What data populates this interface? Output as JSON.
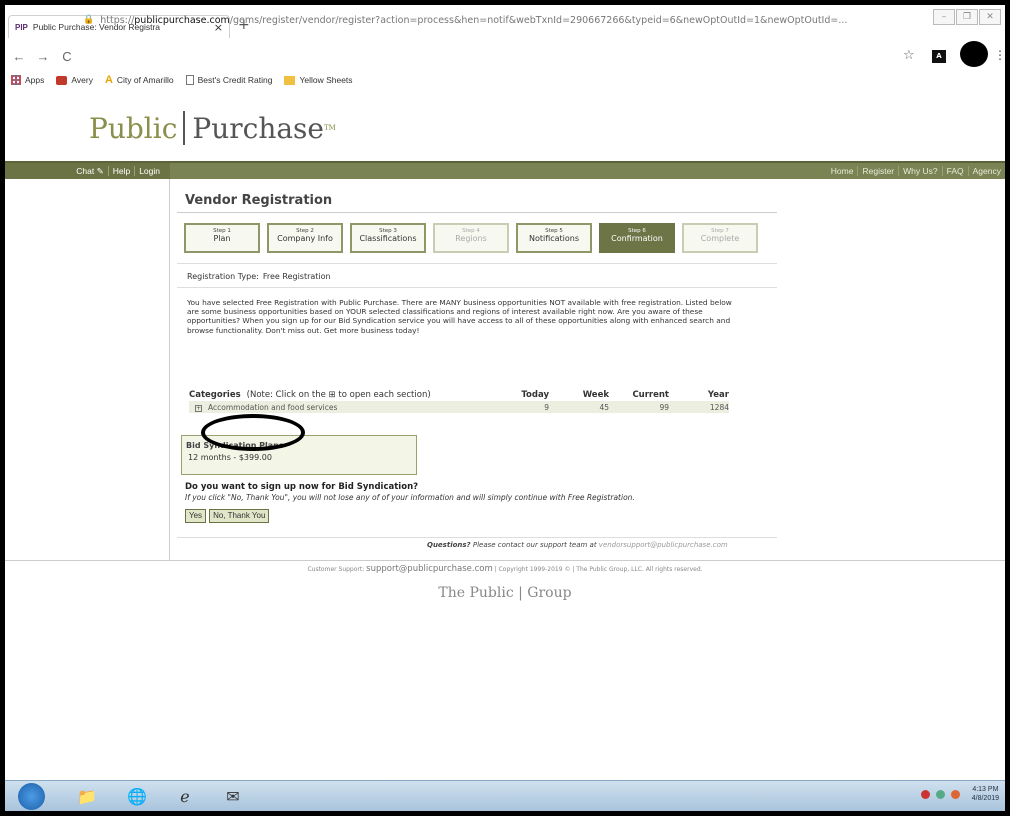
{
  "browser": {
    "tab_favicon": "PIP",
    "tab_title": "Public Purchase: Vendor Registra",
    "tab_close": "×",
    "new_tab": "+",
    "url_prefix": "https://",
    "url_domain": "publicpurchase.com",
    "url_path": "/gems/register/vendor/register?action=process&hen=notif&webTxnId=290667266&typeid=6&newOptOutId=1&newOptOutId=...",
    "bookmarks": [
      "Apps",
      "Avery",
      "City of Amarillo",
      "Best's Credit Rating",
      "Yellow Sheets"
    ]
  },
  "site": {
    "logo_left": "Public",
    "logo_right": "Purchase",
    "logo_tm": "TM",
    "left_nav": [
      "Chat ✎",
      "Help",
      "Login"
    ],
    "right_nav": [
      "Home",
      "Register",
      "Why Us?",
      "FAQ",
      "Agency"
    ]
  },
  "main": {
    "title": "Vendor Registration",
    "steps": [
      {
        "num": "Step 1",
        "label": "Plan",
        "state": "done"
      },
      {
        "num": "Step 2",
        "label": "Company Info",
        "state": "done"
      },
      {
        "num": "Step 3",
        "label": "Classifications",
        "state": "done"
      },
      {
        "num": "Step 4",
        "label": "Regions",
        "state": "off"
      },
      {
        "num": "Step 5",
        "label": "Notifications",
        "state": "done"
      },
      {
        "num": "Step 6",
        "label": "Confirmation",
        "state": "current"
      },
      {
        "num": "Step 7",
        "label": "Complete",
        "state": "off"
      }
    ],
    "reg_type_label": "Registration Type:",
    "reg_type_value": "Free Registration",
    "paragraph": "You have selected Free Registration with Public Purchase. There are MANY business opportunities NOT available with free registration. Listed below are some business opportunities based on YOUR selected classifications and regions of interest available right now. Are you aware of these opportunities? When you sign up for our Bid Syndication service you will have access to all of these opportunities along with enhanced search and browse functionality. Don't miss out. Get more business today!",
    "categories": {
      "header": "Categories",
      "note": "(Note: Click on the ⊞ to open each section)",
      "cols": [
        "Today",
        "Week",
        "Current",
        "Year"
      ],
      "rows": [
        {
          "name": "Accommodation and food services",
          "today": "9",
          "week": "45",
          "current": "99",
          "year": "1284"
        }
      ]
    },
    "plans_title": "Bid Syndication Plans",
    "plans_price": "12 months - $399.00",
    "ask": "Do you want to sign up now for Bid Syndication?",
    "ask_info": "If you click \"No, Thank You\", you will not lose any of of your information and will simply continue with Free Registration.",
    "yes_label": "Yes",
    "no_label": "No, Thank You",
    "questions_bold": "Questions?",
    "questions_text": "Please contact our support team at",
    "questions_email": "vendorsupport@publicpurchase.com"
  },
  "footer": {
    "support_label": "Customer Support:",
    "support_email": "support@publicpurchase.com",
    "copyright": "| Copyright 1999-2019 © | The Public Group, LLC. All rights reserved.",
    "group_logo": "The Public | Group"
  },
  "taskbar": {
    "time": "4:13 PM",
    "date": "4/8/2019"
  }
}
